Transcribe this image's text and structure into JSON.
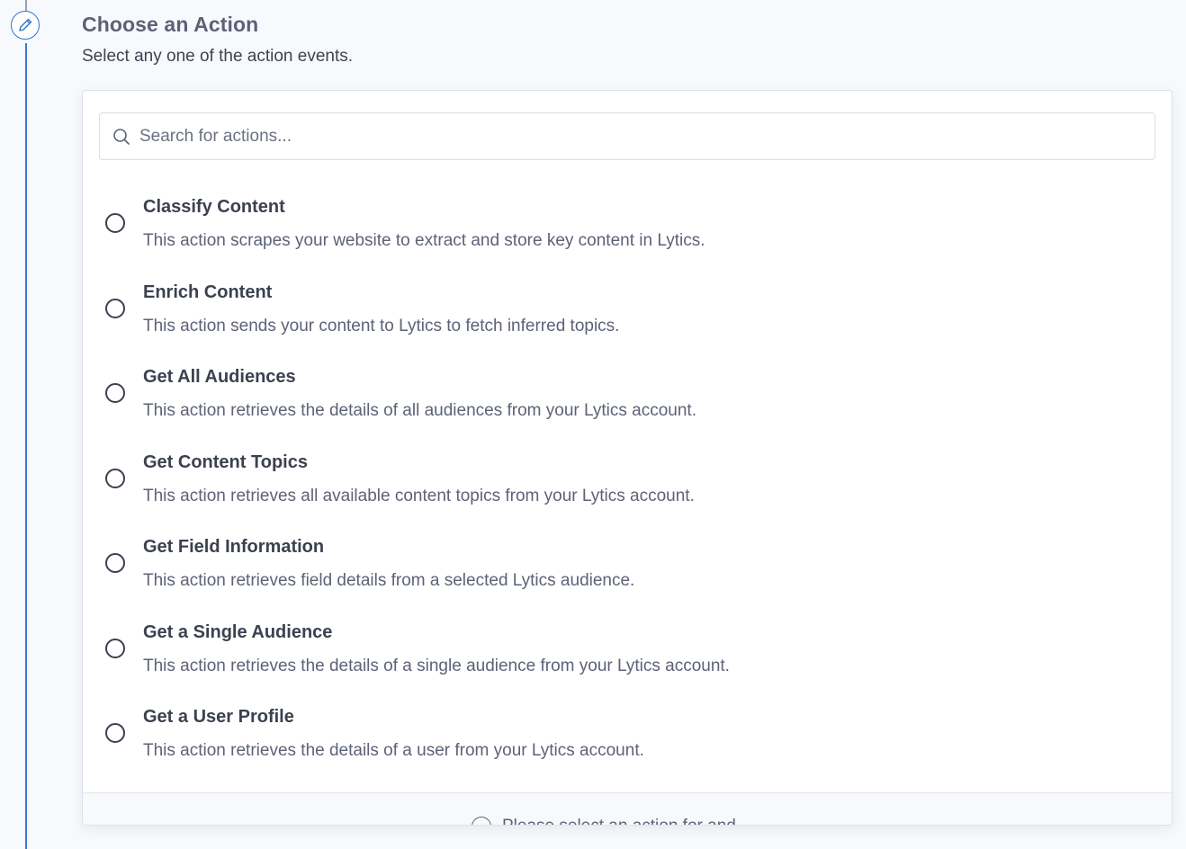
{
  "header": {
    "title": "Choose an Action",
    "subtitle": "Select any one of the action events."
  },
  "step": {
    "icon": "pencil-icon"
  },
  "search": {
    "placeholder": "Search for actions...",
    "value": ""
  },
  "actions": [
    {
      "title": "Classify Content",
      "description": "This action scrapes your website to extract and store key content in Lytics."
    },
    {
      "title": "Enrich Content",
      "description": "This action sends your content to Lytics to fetch inferred topics."
    },
    {
      "title": "Get All Audiences",
      "description": "This action retrieves the details of all audiences from your Lytics account."
    },
    {
      "title": "Get Content Topics",
      "description": "This action retrieves all available content topics from your Lytics account."
    },
    {
      "title": "Get Field Information",
      "description": "This action retrieves field details from a selected Lytics audience."
    },
    {
      "title": "Get a Single Audience",
      "description": "This action retrieves the details of a single audience from your Lytics account."
    },
    {
      "title": "Get a User Profile",
      "description": "This action retrieves the details of a user from your Lytics account."
    }
  ],
  "footer": {
    "hint": "Please select an action for and"
  },
  "colors": {
    "accent": "#2f74d0",
    "rail": "#3b78d6",
    "text": "#3c4150",
    "muted": "#5d6277"
  }
}
